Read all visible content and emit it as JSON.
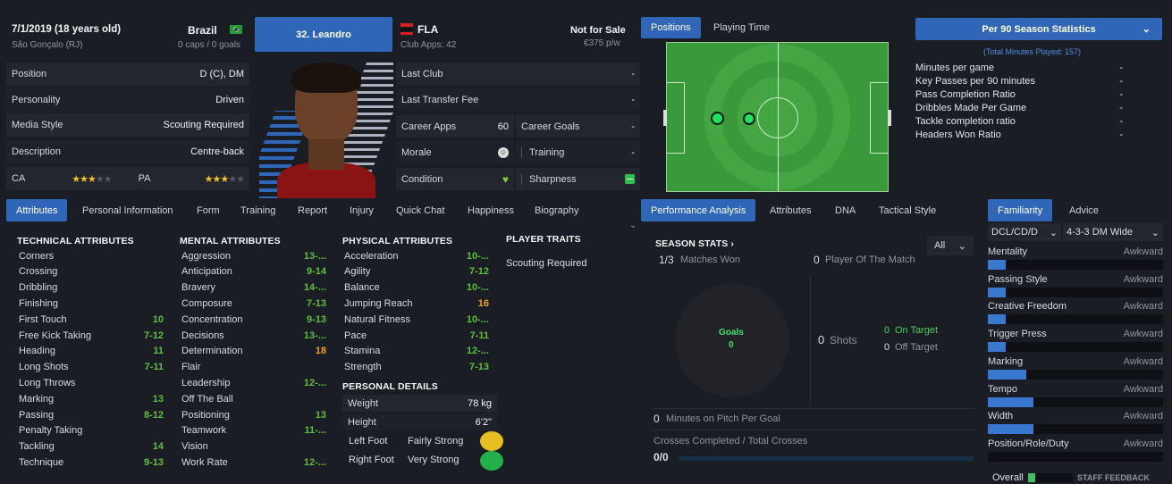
{
  "profile": {
    "date": "7/1/2019 (18 years old)",
    "birthplace": "São Gonçalo (RJ)",
    "nation": "Brazil",
    "caps": "0 caps / 0 goals",
    "name_button": "32. Leandro",
    "club": "FLA",
    "club_apps": "Club Apps: 42",
    "sale": "Not for Sale",
    "wage": "€375 p/w"
  },
  "info_rows": [
    {
      "label": "Position",
      "value": "D (C), DM"
    },
    {
      "label": "Personality",
      "value": "Driven"
    },
    {
      "label": "Media Style",
      "value": "Scouting Required"
    },
    {
      "label": "Description",
      "value": "Centre-back"
    }
  ],
  "ability": {
    "ca_label": "CA",
    "ca_stars": 3,
    "pa_label": "PA",
    "pa_stars": 3
  },
  "club_rows": {
    "last_club": "Last Club",
    "last_club_val": "-",
    "last_fee": "Last Transfer Fee",
    "last_fee_val": "-",
    "career_apps": "Career Apps",
    "career_apps_val": "60",
    "career_goals": "Career Goals",
    "career_goals_val": "-",
    "morale": "Morale",
    "training": "Training",
    "training_val": "-",
    "condition": "Condition",
    "sharpness": "Sharpness"
  },
  "left_tabs": [
    "Attributes",
    "Personal Information",
    "Form",
    "Training",
    "Report",
    "Injury",
    "Quick Chat",
    "Happiness",
    "Biography"
  ],
  "technical": {
    "title": "TECHNICAL ATTRIBUTES",
    "items": [
      [
        "Corners",
        ""
      ],
      [
        "Crossing",
        ""
      ],
      [
        "Dribbling",
        ""
      ],
      [
        "Finishing",
        ""
      ],
      [
        "First Touch",
        "10"
      ],
      [
        "Free Kick Taking",
        "7-12"
      ],
      [
        "Heading",
        "11"
      ],
      [
        "Long Shots",
        "7-11"
      ],
      [
        "Long Throws",
        ""
      ],
      [
        "Marking",
        "13"
      ],
      [
        "Passing",
        "8-12"
      ],
      [
        "Penalty Taking",
        ""
      ],
      [
        "Tackling",
        "14"
      ],
      [
        "Technique",
        "9-13"
      ]
    ]
  },
  "mental": {
    "title": "MENTAL ATTRIBUTES",
    "items": [
      [
        "Aggression",
        "13-..."
      ],
      [
        "Anticipation",
        "9-14"
      ],
      [
        "Bravery",
        "14-..."
      ],
      [
        "Composure",
        "7-13"
      ],
      [
        "Concentration",
        "9-13"
      ],
      [
        "Decisions",
        "13-..."
      ],
      [
        "Determination",
        "18"
      ],
      [
        "Flair",
        ""
      ],
      [
        "Leadership",
        "12-..."
      ],
      [
        "Off The Ball",
        ""
      ],
      [
        "Positioning",
        "13"
      ],
      [
        "Teamwork",
        "11-..."
      ],
      [
        "Vision",
        ""
      ],
      [
        "Work Rate",
        "12-..."
      ]
    ]
  },
  "physical": {
    "title": "PHYSICAL ATTRIBUTES",
    "items": [
      [
        "Acceleration",
        "10-..."
      ],
      [
        "Agility",
        "7-12"
      ],
      [
        "Balance",
        "10-..."
      ],
      [
        "Jumping Reach",
        "16"
      ],
      [
        "Natural Fitness",
        "10-..."
      ],
      [
        "Pace",
        "7-11"
      ],
      [
        "Stamina",
        "12-..."
      ],
      [
        "Strength",
        "7-13"
      ]
    ]
  },
  "traits": {
    "title": "PLAYER TRAITS",
    "text": "Scouting Required"
  },
  "personal": {
    "title": "PERSONAL DETAILS",
    "weight_label": "Weight",
    "weight": "78 kg",
    "height_label": "Height",
    "height": "6'2\"",
    "left_foot": "Left Foot",
    "left_val": "Fairly Strong",
    "right_foot": "Right Foot",
    "right_val": "Very Strong"
  },
  "pitch_tabs": [
    "Positions",
    "Playing Time"
  ],
  "stats_dropdown": "Per 90 Season Statistics",
  "minutes_played": "(Total Minutes Played: 157)",
  "stats": [
    [
      "Minutes per game",
      "-"
    ],
    [
      "Key Passes per 90 minutes",
      "-"
    ],
    [
      "Pass Completion Ratio",
      "-"
    ],
    [
      "Dribbles Made Per Game",
      "-"
    ],
    [
      "Tackle completion ratio",
      "-"
    ],
    [
      "Headers Won Ratio",
      "-"
    ]
  ],
  "perf_tabs": [
    "Performance Analysis",
    "Attributes",
    "DNA",
    "Tactical Style"
  ],
  "season": {
    "title": "SEASON STATS",
    "filter": "All",
    "matches_won_num": "1/3",
    "matches_won": "Matches Won",
    "potm_num": "0",
    "potm": "Player Of The Match",
    "goals_label": "Goals",
    "goals": "0",
    "shots_num": "0",
    "shots": "Shots",
    "on_target_num": "0",
    "on_target": "On Target",
    "off_target_num": "0",
    "off_target": "Off Target",
    "mins_num": "0",
    "mins": "Minutes on Pitch Per Goal",
    "crosses": "Crosses Completed / Total Crosses",
    "crosses_val": "0/0"
  },
  "fam_tabs": [
    "Familiarity",
    "Advice"
  ],
  "fam_pos": "DCL/CD/D",
  "fam_formation": "4-3-3 DM Wide",
  "familiarity": [
    {
      "label": "Mentality",
      "value": "Awkward",
      "level": 0.1
    },
    {
      "label": "Passing Style",
      "value": "Awkward",
      "level": 0.1
    },
    {
      "label": "Creative Freedom",
      "value": "Awkward",
      "level": 0.1
    },
    {
      "label": "Trigger Press",
      "value": "Awkward",
      "level": 0.1
    },
    {
      "label": "Marking",
      "value": "Awkward",
      "level": 0.22
    },
    {
      "label": "Tempo",
      "value": "Awkward",
      "level": 0.26
    },
    {
      "label": "Width",
      "value": "Awkward",
      "level": 0.26
    },
    {
      "label": "Position/Role/Duty",
      "value": "Awkward",
      "level": 0.0
    }
  ],
  "overall": "Overall",
  "staff_feedback": "STAFF FEEDBACK"
}
